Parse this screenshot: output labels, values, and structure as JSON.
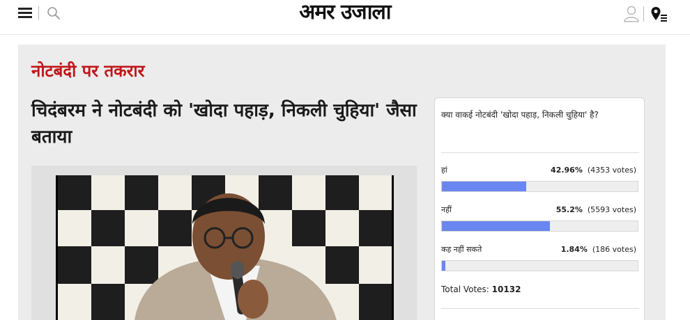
{
  "header": {
    "logo_text": "अमर उजाला",
    "icons": [
      "menu-icon",
      "search-icon",
      "user-icon",
      "location-list-icon"
    ]
  },
  "article": {
    "kicker": "नोटबंदी पर तकरार",
    "headline": "चिदंबरम ने नोटबंदी को 'खोदा पहाड़, निकली चुहिया' जैसा बताया"
  },
  "poll": {
    "question": "क्या वाकई नोटबंदी 'खोदा पहाड़, निकली चुहिया' है?",
    "options": [
      {
        "label": "हां",
        "percent": "42.96%",
        "votes": "(4353 votes)",
        "fill": 42.96
      },
      {
        "label": "नहीं",
        "percent": "55.2%",
        "votes": "(5593 votes)",
        "fill": 55.2
      },
      {
        "label": "कह नहीं सकते",
        "percent": "1.84%",
        "votes": "(186 votes)",
        "fill": 1.84
      }
    ],
    "total_label": "Total Votes:",
    "total_value": "10132",
    "bar_color": "#6a86f0"
  },
  "colors": {
    "kicker": "#c0161b",
    "panel": "#ececec"
  }
}
